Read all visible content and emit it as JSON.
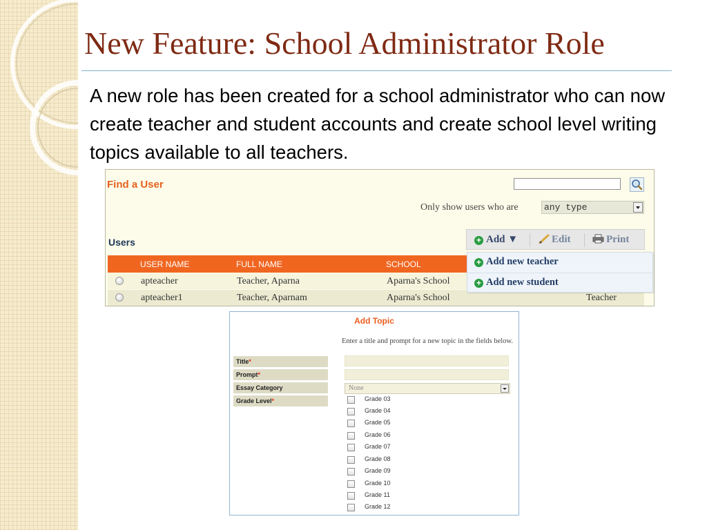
{
  "slide": {
    "title": "New Feature: School Administrator Role",
    "body": "A new role has been created for a school administrator who can now create teacher and student accounts and create school level writing topics available to all teachers."
  },
  "find_user": {
    "title": "Find a User",
    "search_value": "",
    "filter_label": "Only show users who are",
    "filter_value": "any type",
    "users_label": "Users",
    "toolbar": {
      "add": "Add ▼",
      "edit": "Edit",
      "print": "Print"
    },
    "table": {
      "headers": [
        "USER NAME",
        "FULL NAME",
        "SCHOOL"
      ],
      "rows": [
        {
          "user_name": "apteacher",
          "full_name": "Teacher, Aparna",
          "school": "Aparna's School",
          "type": ""
        },
        {
          "user_name": "apteacher1",
          "full_name": "Teacher, Aparnam",
          "school": "Aparna's School",
          "type": "Teacher"
        }
      ]
    },
    "add_menu": [
      "Add new teacher",
      "Add new student"
    ]
  },
  "add_topic": {
    "title": "Add Topic",
    "instructions": "Enter a title and prompt for a new topic in the fields below.",
    "fields": {
      "title": "Title",
      "prompt": "Prompt",
      "essay_category": "Essay Category",
      "grade_level": "Grade Level",
      "required_mark": "*"
    },
    "title_value": "",
    "prompt_value": "",
    "category_value": "None",
    "grades": [
      "Grade 03",
      "Grade 04",
      "Grade 05",
      "Grade 06",
      "Grade 07",
      "Grade 08",
      "Grade 09",
      "Grade 10",
      "Grade 11",
      "Grade 12"
    ]
  },
  "colors": {
    "title": "#7f2a14",
    "accent_orange": "#f06621",
    "panel_bg": "#fdfcea",
    "link_blue": "#243d66",
    "sidebar": "#f6ebcd"
  }
}
